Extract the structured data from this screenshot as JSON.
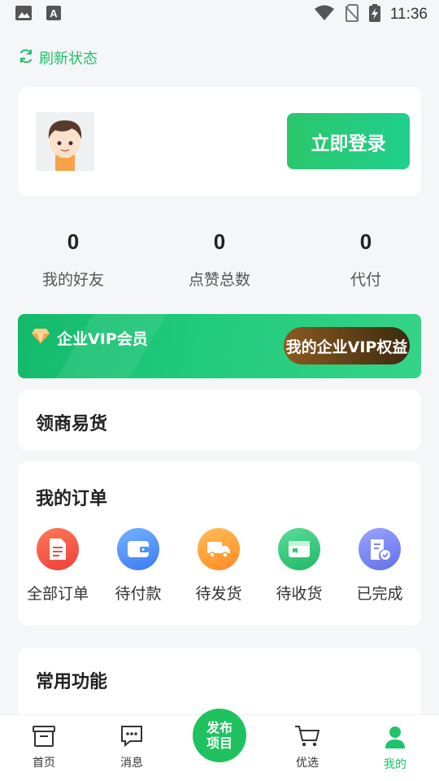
{
  "status_bar": {
    "time": "11:36",
    "icons": [
      "image-icon",
      "a-notification-icon",
      "wifi-icon",
      "no-sim-icon",
      "battery-charging-icon"
    ]
  },
  "refresh": {
    "label": "刷新状态",
    "icon": "refresh-icon"
  },
  "profile": {
    "login_label": "立即登录",
    "avatar": "avatar-icon"
  },
  "stats": [
    {
      "value": "0",
      "label": "我的好友"
    },
    {
      "value": "0",
      "label": "点赞总数"
    },
    {
      "value": "0",
      "label": "代付"
    }
  ],
  "vip": {
    "title": "企业VIP会员",
    "button": "我的企业VIP权益",
    "icon": "diamond-icon"
  },
  "lingshang": {
    "title": "领商易货"
  },
  "orders": {
    "title": "我的订单",
    "items": [
      {
        "label": "全部订单",
        "icon": "document-icon",
        "color": "#f2564a"
      },
      {
        "label": "待付款",
        "icon": "wallet-icon",
        "color": "#4f8ef7"
      },
      {
        "label": "待发货",
        "icon": "truck-icon",
        "color": "#ff9a2e"
      },
      {
        "label": "待收货",
        "icon": "inbox-icon",
        "color": "#2ec77c"
      },
      {
        "label": "已完成",
        "icon": "completed-icon",
        "color": "#7b86f0"
      }
    ]
  },
  "common": {
    "title": "常用功能"
  },
  "tabbar": {
    "items": [
      {
        "label": "首页",
        "icon": "home-box-icon"
      },
      {
        "label": "消息",
        "icon": "message-icon"
      },
      {
        "label": "优选",
        "icon": "cart-icon"
      },
      {
        "label": "我的",
        "icon": "user-icon"
      }
    ],
    "publish_line1": "发布",
    "publish_line2": "项目",
    "active_color": "#1ec36b"
  }
}
